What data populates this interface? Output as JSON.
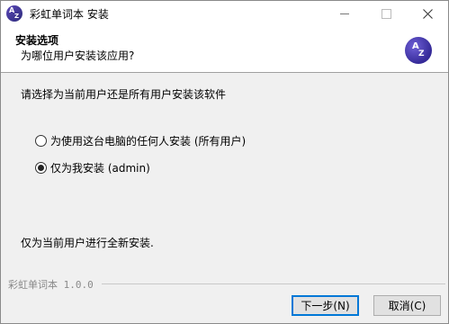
{
  "window": {
    "title": "彩虹单词本 安装"
  },
  "header": {
    "title": "安装选项",
    "subtitle": "为哪位用户安装该应用?",
    "logo_a": "A",
    "logo_z": "Z"
  },
  "content": {
    "prompt": "请选择为当前用户还是所有用户安装该软件",
    "options": [
      {
        "label": "为使用这台电脑的任何人安装 (所有用户)",
        "selected": false
      },
      {
        "label": "仅为我安装 (admin)",
        "selected": true
      }
    ],
    "info": "仅为当前用户进行全新安装."
  },
  "footer": {
    "brand": "彩虹单词本 1.0.0"
  },
  "buttons": {
    "next": "下一步(N)",
    "cancel": "取消(C)"
  }
}
